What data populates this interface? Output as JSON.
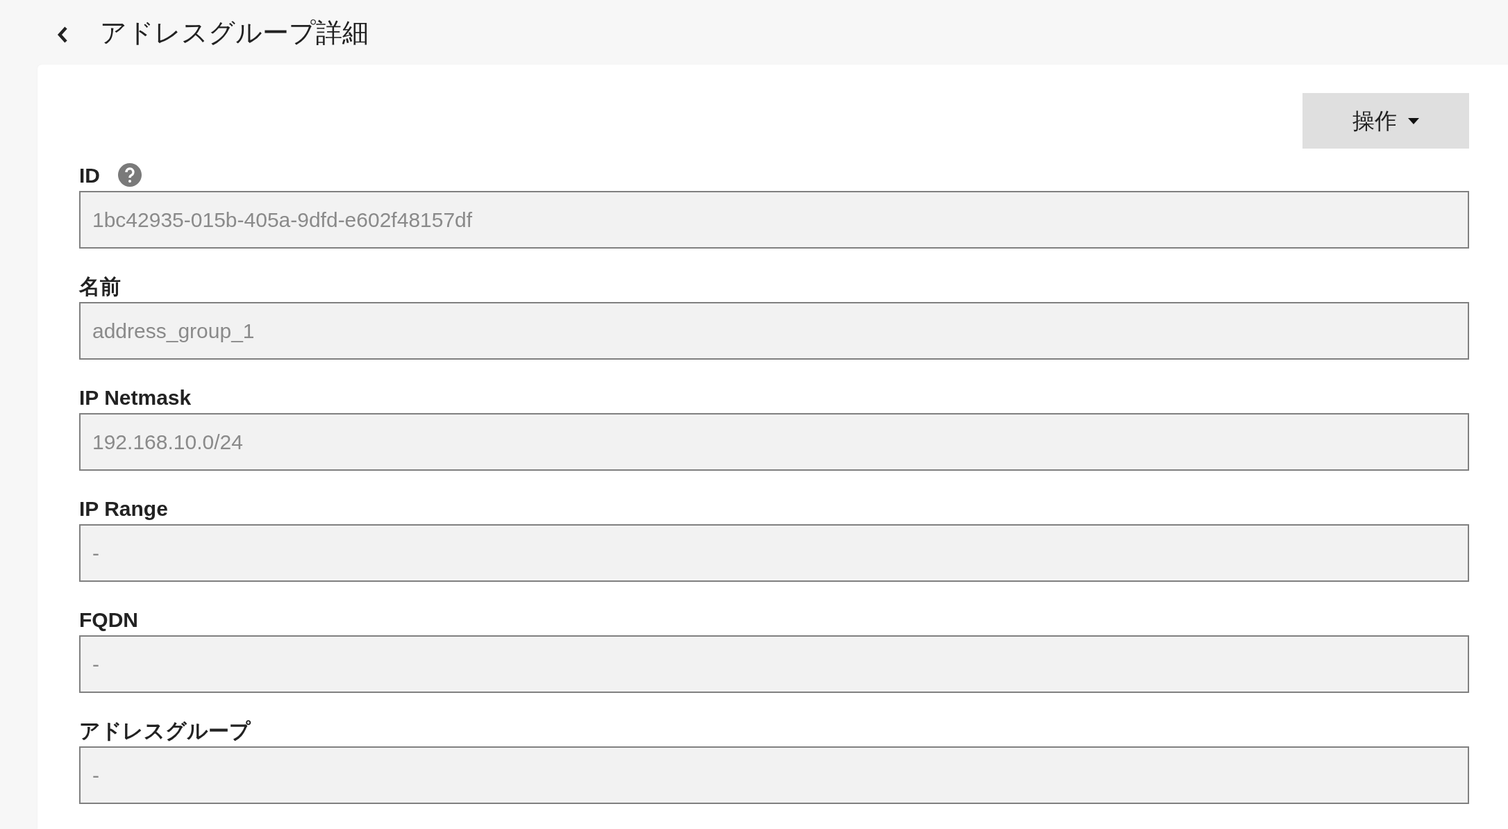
{
  "header": {
    "title": "アドレスグループ詳細"
  },
  "actions_button": {
    "label": "操作"
  },
  "fields": [
    {
      "label": "ID",
      "help": true,
      "value": "1bc42935-015b-405a-9dfd-e602f48157df"
    },
    {
      "label": "名前",
      "help": false,
      "value": "address_group_1"
    },
    {
      "label": "IP Netmask",
      "help": false,
      "value": "192.168.10.0/24"
    },
    {
      "label": "IP Range",
      "help": false,
      "value": "-"
    },
    {
      "label": "FQDN",
      "help": false,
      "value": "-"
    },
    {
      "label": "アドレスグループ",
      "help": false,
      "value": "-"
    }
  ]
}
